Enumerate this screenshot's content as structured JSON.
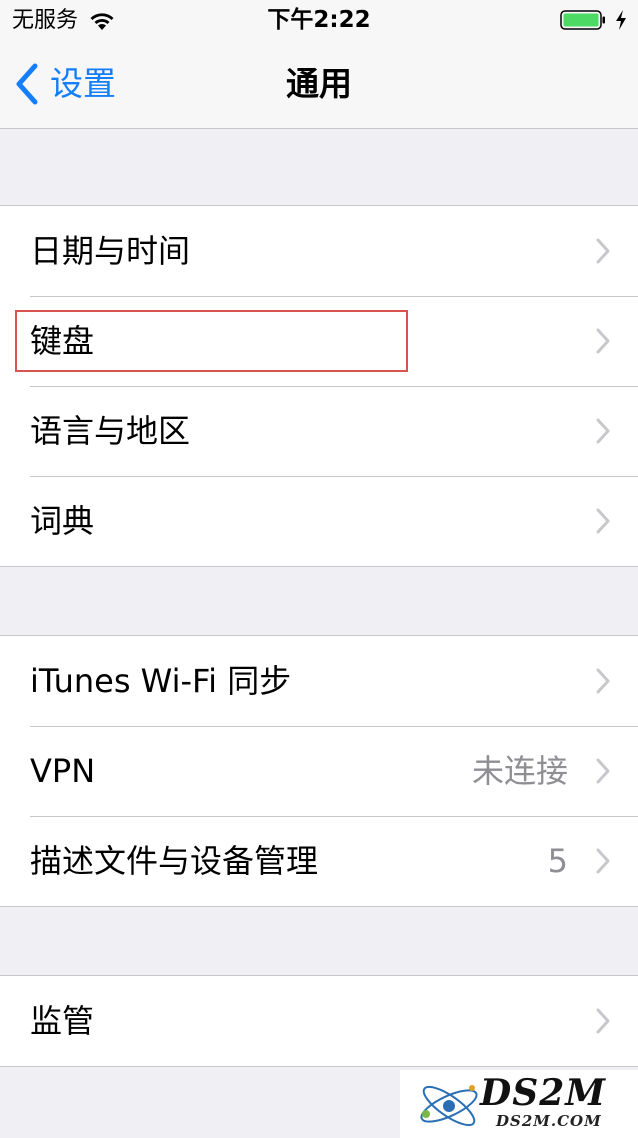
{
  "status_bar": {
    "carrier": "无服务",
    "time": "下午2:22"
  },
  "nav": {
    "back_label": "设置",
    "title": "通用"
  },
  "groups": [
    {
      "items": [
        {
          "label": "日期与时间"
        },
        {
          "label": "键盘"
        },
        {
          "label": "语言与地区"
        },
        {
          "label": "词典"
        }
      ]
    },
    {
      "items": [
        {
          "label": "iTunes Wi-Fi 同步"
        },
        {
          "label": "VPN",
          "value": "未连接"
        },
        {
          "label": "描述文件与设备管理",
          "value": "5"
        }
      ]
    },
    {
      "items": [
        {
          "label": "监管"
        }
      ]
    }
  ],
  "watermark": {
    "brand": "DS2M",
    "domain": "DS2M.COM"
  },
  "colors": {
    "accent": "#157efb",
    "battery": "#4cd964",
    "highlight": "#d9534f"
  }
}
